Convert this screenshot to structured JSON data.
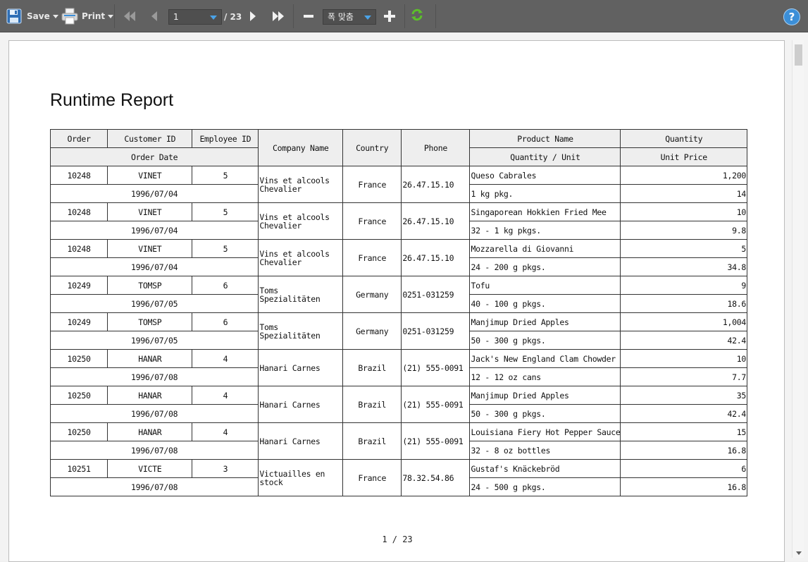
{
  "toolbar": {
    "save_label": "Save",
    "print_label": "Print",
    "page_current": "1",
    "page_total": "/ 23",
    "zoom_value": "폭 맞춤",
    "help_label": "?"
  },
  "report": {
    "title": "Runtime Report",
    "headers": {
      "order": "Order",
      "customer_id": "Customer ID",
      "employee_id": "Employee ID",
      "order_date": "Order Date",
      "company_name": "Company Name",
      "country": "Country",
      "phone": "Phone",
      "product_name": "Product Name",
      "quantity_per_unit": "Quantity / Unit",
      "quantity": "Quantity",
      "unit_price": "Unit Price"
    },
    "rows": [
      {
        "order": "10248",
        "customer": "VINET",
        "employee": "5",
        "date": "1996/07/04",
        "company": "Vins et alcools Chevalier",
        "country": "France",
        "phone": "26.47.15.10",
        "product": "Queso Cabrales",
        "qpu": "1 kg pkg.",
        "quantity": "1,200",
        "price": "14"
      },
      {
        "order": "10248",
        "customer": "VINET",
        "employee": "5",
        "date": "1996/07/04",
        "company": "Vins et alcools Chevalier",
        "country": "France",
        "phone": "26.47.15.10",
        "product": "Singaporean Hokkien Fried Mee",
        "qpu": "32 - 1 kg pkgs.",
        "quantity": "10",
        "price": "9.8"
      },
      {
        "order": "10248",
        "customer": "VINET",
        "employee": "5",
        "date": "1996/07/04",
        "company": "Vins et alcools Chevalier",
        "country": "France",
        "phone": "26.47.15.10",
        "product": "Mozzarella di Giovanni",
        "qpu": "24 - 200 g pkgs.",
        "quantity": "5",
        "price": "34.8"
      },
      {
        "order": "10249",
        "customer": "TOMSP",
        "employee": "6",
        "date": "1996/07/05",
        "company": "Toms Spezialitäten",
        "country": "Germany",
        "phone": "0251-031259",
        "product": "Tofu",
        "qpu": "40 - 100 g pkgs.",
        "quantity": "9",
        "price": "18.6"
      },
      {
        "order": "10249",
        "customer": "TOMSP",
        "employee": "6",
        "date": "1996/07/05",
        "company": "Toms Spezialitäten",
        "country": "Germany",
        "phone": "0251-031259",
        "product": "Manjimup Dried Apples",
        "qpu": "50 - 300 g pkgs.",
        "quantity": "1,004",
        "price": "42.4"
      },
      {
        "order": "10250",
        "customer": "HANAR",
        "employee": "4",
        "date": "1996/07/08",
        "company": "Hanari Carnes",
        "country": "Brazil",
        "phone": "(21) 555-0091",
        "product": "Jack's New England Clam Chowder",
        "qpu": "12 - 12 oz cans",
        "quantity": "10",
        "price": "7.7"
      },
      {
        "order": "10250",
        "customer": "HANAR",
        "employee": "4",
        "date": "1996/07/08",
        "company": "Hanari Carnes",
        "country": "Brazil",
        "phone": "(21) 555-0091",
        "product": "Manjimup Dried Apples",
        "qpu": "50 - 300 g pkgs.",
        "quantity": "35",
        "price": "42.4"
      },
      {
        "order": "10250",
        "customer": "HANAR",
        "employee": "4",
        "date": "1996/07/08",
        "company": "Hanari Carnes",
        "country": "Brazil",
        "phone": "(21) 555-0091",
        "product": "Louisiana Fiery Hot Pepper Sauce",
        "qpu": "32 - 8 oz bottles",
        "quantity": "15",
        "price": "16.8"
      },
      {
        "order": "10251",
        "customer": "VICTE",
        "employee": "3",
        "date": "1996/07/08",
        "company": "Victuailles en stock",
        "country": "France",
        "phone": "78.32.54.86",
        "product": "Gustaf's Knäckebröd",
        "qpu": "24 - 500 g pkgs.",
        "quantity": "6",
        "price": "16.8"
      }
    ],
    "pager": "1 / 23"
  },
  "icons": {
    "save": "floppy-disk-icon",
    "print": "printer-icon",
    "first": "first-page-icon",
    "prev": "prev-page-icon",
    "next": "next-page-icon",
    "last": "last-page-icon",
    "zoom_out": "minus-icon",
    "zoom_in": "plus-icon",
    "refresh": "refresh-icon",
    "help": "help-icon"
  },
  "colors": {
    "toolbar_bg": "#616161",
    "accent": "#3c8fd8",
    "refresh": "#5cbf2a"
  }
}
